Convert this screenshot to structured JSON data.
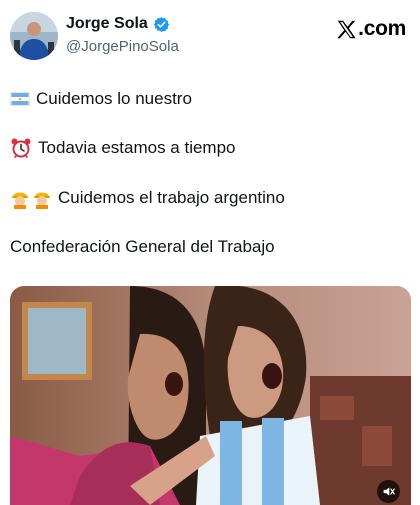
{
  "author": {
    "display_name": "Jorge Sola",
    "handle": "@JorgePinoSola",
    "verified": true
  },
  "brand": {
    "icon": "x-logo-icon",
    "suffix": ".com"
  },
  "tweet": {
    "lines": [
      {
        "emoji": "argentina-flag-icon",
        "text": "Cuidemos lo nuestro"
      },
      {
        "emoji": "alarm-clock-icon",
        "text": "Todavia estamos a tiempo"
      },
      {
        "emoji": "construction-worker-icon",
        "text": "Cuidemos el trabajo argentino"
      },
      {
        "emoji": "",
        "text": "Confederación General del Trabajo"
      }
    ]
  },
  "media": {
    "type": "video",
    "control_icon": "volume-mute-icon"
  },
  "colors": {
    "text": "#0f1419",
    "secondary": "#536471",
    "verified": "#1d9bf0",
    "flag_blue": "#74acdf",
    "flag_sun": "#f6b40e"
  }
}
